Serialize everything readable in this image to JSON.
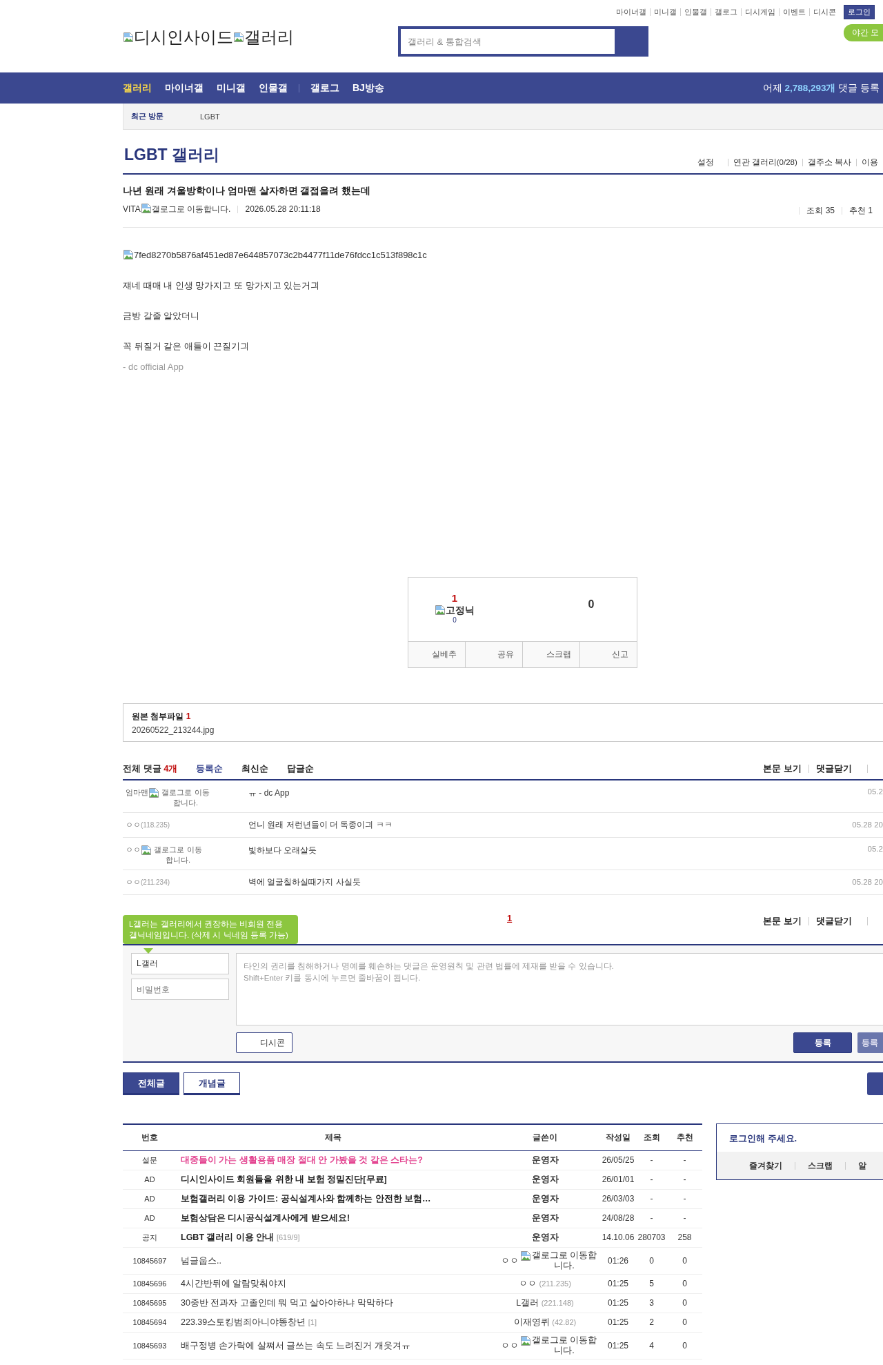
{
  "top_links": [
    "마이너갤",
    "미니갤",
    "인물갤",
    "갤로그",
    "디시게임",
    "이벤트",
    "디시콘"
  ],
  "login_button": "로그인",
  "night_mode_button": "야간 모",
  "logo": {
    "site": "디시인사이드",
    "section": "갤러리"
  },
  "search": {
    "placeholder": "갤러리 & 통합검색"
  },
  "nav": {
    "groups": [
      [
        {
          "label": "갤러리",
          "selected": true
        },
        {
          "label": "마이너갤",
          "selected": false
        },
        {
          "label": "미니갤",
          "selected": false
        },
        {
          "label": "인물갤",
          "selected": false
        }
      ],
      [
        {
          "label": "갤로그",
          "selected": false
        },
        {
          "label": "BJ방송",
          "selected": false
        }
      ]
    ],
    "stats": {
      "prefix": "어제",
      "count": "2,788,293개",
      "suffix": "댓글 등록"
    }
  },
  "recent": {
    "label": "최근 방문",
    "items": [
      "LGBT"
    ]
  },
  "gallery": {
    "title": "LGBT 갤러리",
    "links": [
      "설정",
      "연관 갤러리(0/28)",
      "갤주소 복사",
      "이용"
    ]
  },
  "post": {
    "title": "나년 원래 겨울방학이나 엄마맨 살자하면 갤접을려 했는데",
    "author": "VITA",
    "author_badge": "갤로그로 이동합니다.",
    "date": "2026.05.28 20:11:18",
    "views": "조회 35",
    "recommends": "추천 1",
    "image_alt": "7fed8270b5876af451ed87e644857073c2b4477f11de76fdcc1c513f898c1c",
    "paragraphs": [
      "쟤네 때매 내 인생 망가지고 또 망가지고 있는거긔",
      "금방 갈줄 알았더니",
      "꼭 뒤질거 같은 애들이 끈질기긔"
    ],
    "signature": "- dc official App"
  },
  "vote": {
    "up_count": "1",
    "fixed_label": "고정닉",
    "fixed_count": "0",
    "down_count": "0",
    "actions": [
      "실베추",
      "공유",
      "스크랩",
      "신고"
    ]
  },
  "attachments": {
    "label": "원본 첨부파일",
    "count": "1",
    "files": [
      "20260522_213244.jpg"
    ]
  },
  "comments": {
    "total_label": "전체 댓글",
    "count": "4개",
    "sorts": [
      {
        "label": "등록순",
        "selected": true
      },
      {
        "label": "최신순",
        "selected": false
      },
      {
        "label": "답글순",
        "selected": false
      }
    ],
    "actions": [
      "본문 보기",
      "댓글닫기"
    ],
    "items": [
      {
        "kind": "member",
        "author": "엄마맨",
        "badge": "갤로그로 이동합니다.",
        "text": "ㅠ - dc App",
        "date": "05.2"
      },
      {
        "kind": "guest",
        "author": "ㅇㅇ",
        "ip": "(118.235)",
        "text": "언니 원래 저런년들이 더 독종이긔 ㅋㅋ",
        "date": "05.28 20"
      },
      {
        "kind": "member",
        "author": "ㅇㅇ",
        "badge": "갤로그로 이동합니다.",
        "text": "빛하보다 오래살듯",
        "date": "05.2"
      },
      {
        "kind": "guest",
        "author": "ㅇㅇ",
        "ip": "(211.234)",
        "text": "벽에 얼굴칠하실때가지 사실듯",
        "date": "05.28 20"
      }
    ]
  },
  "pagination": [
    {
      "label": "1",
      "selected": true
    }
  ],
  "comment_actions_bottom": [
    "본문 보기",
    "댓글닫기"
  ],
  "comment_form": {
    "tooltip": "L갤러는 갤러리에서 권장하는 비회원 전용 갤닉네임입니다. (삭제 시 닉네임 등록 가능)",
    "nickname": "L갤러",
    "password_placeholder": "비밀번호",
    "body_placeholder": "타인의 권리를 침해하거나 명예를 훼손하는 댓글은 운영원칙 및 관련 법률에 제재를 받을 수 있습니다.\nShift+Enter 키를 동시에 누르면 줄바꿈이 됩니다.",
    "dccon_button": "디시콘",
    "submit_button": "등록",
    "submit_recommend_button": "등록"
  },
  "list_tabs": [
    {
      "label": "전체글",
      "selected": true
    },
    {
      "label": "개념글",
      "selected": false
    }
  ],
  "table": {
    "columns": [
      "번호",
      "제목",
      "글쓴이",
      "작성일",
      "조회",
      "추천"
    ],
    "rows": [
      {
        "kind": "survey",
        "number": "설문",
        "title": "대중들이 가는 생활용품 매장 절대 안 가봤을 것 같은 스타는?",
        "author": {
          "kind": "admin",
          "name": "운영자"
        },
        "date": "26/05/25",
        "views": "-",
        "recommends": "-"
      },
      {
        "kind": "ad",
        "number": "AD",
        "title": "디시인사이드 회원들을 위한 내 보험 정밀진단[무료]",
        "author": {
          "kind": "admin",
          "name": "운영자"
        },
        "date": "26/01/01",
        "views": "-",
        "recommends": "-"
      },
      {
        "kind": "ad",
        "number": "AD",
        "title": "보험갤러리 이용 가이드: 공식설계사와 함께하는 안전한 보험…",
        "author": {
          "kind": "admin",
          "name": "운영자"
        },
        "date": "26/03/03",
        "views": "-",
        "recommends": "-"
      },
      {
        "kind": "ad",
        "number": "AD",
        "title": "보험상담은 디시공식설계사에게 받으세요!",
        "author": {
          "kind": "admin",
          "name": "운영자"
        },
        "date": "24/08/28",
        "views": "-",
        "recommends": "-"
      },
      {
        "kind": "notice",
        "number": "공지",
        "title": "LGBT 갤러리 이용 안내",
        "reply_count": "[619/9]",
        "author": {
          "kind": "admin",
          "name": "운영자"
        },
        "date": "14.10.06",
        "views": "280703",
        "recommends": "258"
      },
      {
        "kind": "post",
        "number": "10845697",
        "title": "넘글웁스..",
        "author": {
          "kind": "member",
          "name": "ㅇㅇ",
          "badge": "갤로그로 이동합니다."
        },
        "date": "01:26",
        "views": "0",
        "recommends": "0"
      },
      {
        "kind": "post",
        "number": "10845696",
        "title": "4시갼반뒤에 알람맞춰야지",
        "author": {
          "kind": "guest",
          "name": "ㅇㅇ",
          "ip": "(211.235)"
        },
        "date": "01:25",
        "views": "5",
        "recommends": "0"
      },
      {
        "kind": "post",
        "number": "10845695",
        "title": "30중반 전과자 고졸인데 뭐 먹고 살아야하냐 막막하다",
        "author": {
          "kind": "guest",
          "name": "L갤러",
          "ip": "(221.148)"
        },
        "date": "01:25",
        "views": "3",
        "recommends": "0"
      },
      {
        "kind": "post",
        "number": "10845694",
        "title": "223.39스토킹범죄아니야똥창년",
        "reply_count": "[1]",
        "author": {
          "kind": "guest",
          "name": "이재영퀴",
          "ip": "(42.82)"
        },
        "date": "01:25",
        "views": "2",
        "recommends": "0"
      },
      {
        "kind": "post",
        "number": "10845693",
        "title": "배구정병 손가락에 살쪄서 글쓰는 속도 느려진거 개웃겨ㅠ",
        "author": {
          "kind": "member",
          "name": "ㅇㅇ",
          "badge": "갤로그로 이동합니다."
        },
        "date": "01:25",
        "views": "4",
        "recommends": "0"
      }
    ]
  },
  "sidebar": {
    "message": "로그인해 주세요.",
    "links": [
      "즐겨찾기",
      "스크랩",
      "알"
    ]
  }
}
